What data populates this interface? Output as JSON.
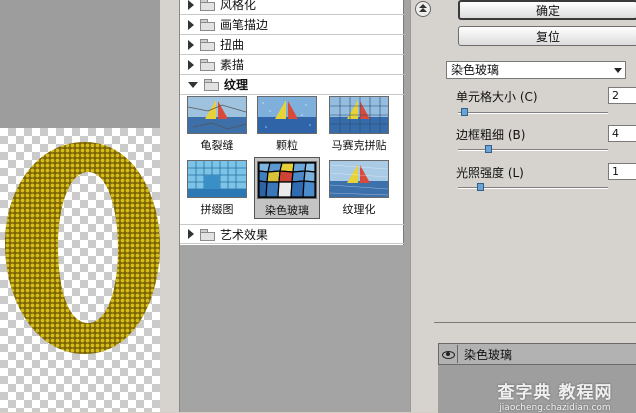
{
  "tree": {
    "categories_top": [
      {
        "label": "风格化",
        "expanded": false
      },
      {
        "label": "画笔描边",
        "expanded": false
      },
      {
        "label": "扭曲",
        "expanded": false
      },
      {
        "label": "素描",
        "expanded": false
      },
      {
        "label": "纹理",
        "expanded": true
      }
    ],
    "texture_filters": [
      {
        "label": "龟裂缝",
        "selected": false
      },
      {
        "label": "颗粒",
        "selected": false
      },
      {
        "label": "马赛克拼贴",
        "selected": false
      },
      {
        "label": "拼缀图",
        "selected": false
      },
      {
        "label": "染色玻璃",
        "selected": true
      },
      {
        "label": "纹理化",
        "selected": false
      }
    ],
    "category_bottom": {
      "label": "艺术效果",
      "expanded": false
    }
  },
  "settings": {
    "ok_label": "确定",
    "reset_label": "复位",
    "filter_select_value": "染色玻璃",
    "params": [
      {
        "label": "单元格大小 (C)",
        "value": "2",
        "slider_fraction": 0.02
      },
      {
        "label": "边框粗细 (B)",
        "value": "4",
        "slider_fraction": 0.19
      },
      {
        "label": "光照强度 (L)",
        "value": "1",
        "slider_fraction": 0.13
      }
    ]
  },
  "layers": {
    "items": [
      {
        "name": "染色玻璃",
        "visible": true
      }
    ]
  },
  "watermark": {
    "line1": "查字典 教程网",
    "line2": "jiaocheng.chazidian.com"
  },
  "colors": {
    "selection": "#c4c4c4",
    "slider_knob": "#6da4d8",
    "preview_glyph": "#b49a0a"
  }
}
